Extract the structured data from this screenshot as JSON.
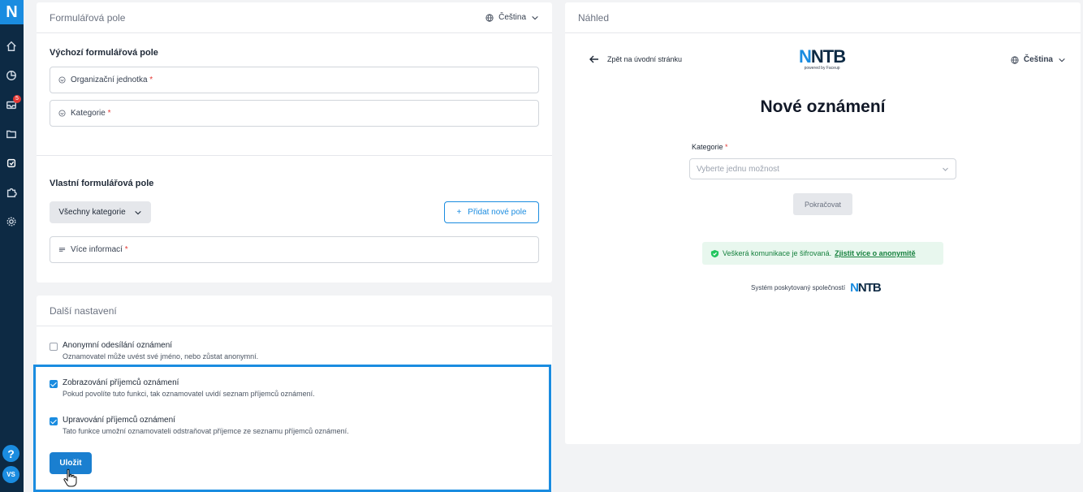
{
  "sidebar": {
    "logo": "N",
    "items": [
      {
        "name": "home-icon"
      },
      {
        "name": "chart-icon"
      },
      {
        "name": "inbox-icon",
        "badge": "5"
      },
      {
        "name": "folder-icon"
      },
      {
        "name": "forms-icon",
        "active": true
      },
      {
        "name": "puzzle-icon"
      },
      {
        "name": "gear-icon"
      }
    ],
    "help": "?",
    "avatar": "VS"
  },
  "form_fields": {
    "header": "Formulářová pole",
    "language": "Čeština",
    "default_title": "Výchozí formulářová pole",
    "default_fields": [
      {
        "label": "Organizační jednotka",
        "required": "*"
      },
      {
        "label": "Kategorie",
        "required": "*"
      }
    ],
    "custom_title": "Vlastní formulářová pole",
    "category_filter": "Všechny kategorie",
    "add_field": "Přidat nové pole",
    "custom_fields": [
      {
        "label": "Více informací",
        "required": "*"
      }
    ]
  },
  "settings": {
    "header": "Další nastavení",
    "options": [
      {
        "label": "Anonymní odesílání oznámení",
        "desc": "Oznamovatel může uvést své jméno, nebo zůstat anonymní.",
        "checked": false
      },
      {
        "label": "Zobrazování příjemců oznámení",
        "desc": "Pokud povolíte tuto funkci, tak oznamovatel uvidí seznam příjemců oznámení.",
        "checked": true
      },
      {
        "label": "Upravování příjemců oznámení",
        "desc": "Tato funkce umožní oznamovateli odstraňovat příjemce ze seznamu příjemců oznámení.",
        "checked": true
      }
    ],
    "save": "Uložit"
  },
  "preview": {
    "header": "Náhled",
    "back": "Zpět na úvodní stránku",
    "brand": "NNTB",
    "brand_sub": "powered by Faceup",
    "language": "Čeština",
    "title": "Nové oznámení",
    "category_label": "Kategorie",
    "category_required": "*",
    "select_placeholder": "Vyberte jednu možnost",
    "continue": "Pokračovat",
    "secure_text": "Veškerá komunikace je šifrovaná.",
    "secure_link": "Zjistit více o anonymitě",
    "provided_by": "Systém poskytovaný společností",
    "provided_brand": "NNTB"
  },
  "colors": {
    "accent": "#1a8ce0",
    "sidebar": "#0d2a44",
    "success": "#15803d"
  }
}
